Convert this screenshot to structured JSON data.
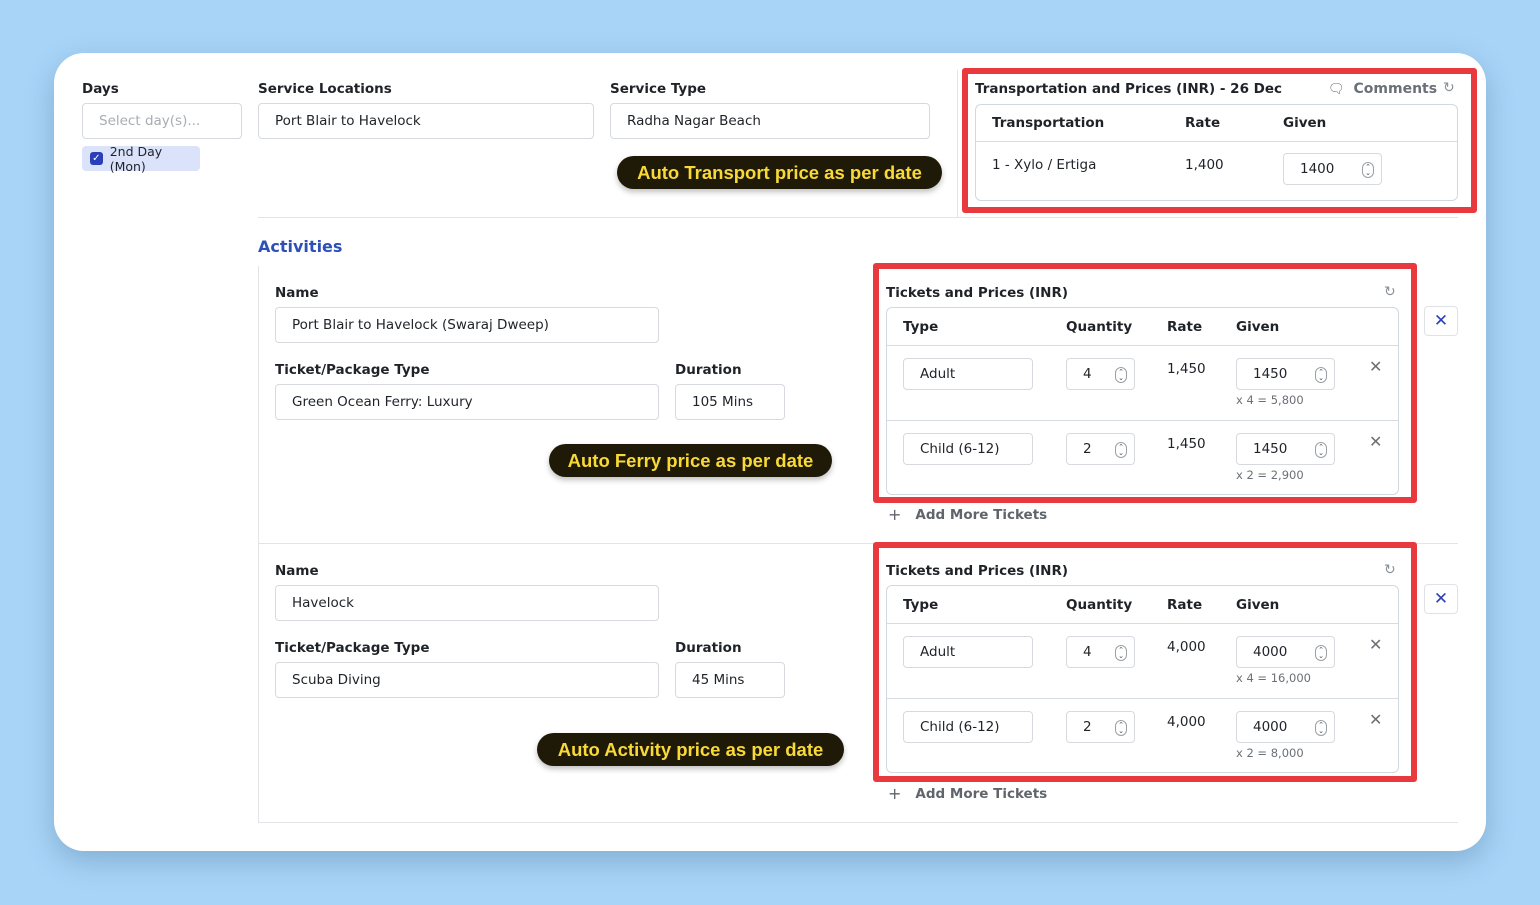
{
  "filters": {
    "days": {
      "label": "Days",
      "placeholder": "Select day(s)...",
      "selected_chip": "2nd Day (Mon)",
      "chip_checked": true
    },
    "service_locations": {
      "label": "Service Locations",
      "value": "Port Blair to Havelock"
    },
    "service_type": {
      "label": "Service Type",
      "value": "Radha Nagar Beach"
    }
  },
  "callouts": {
    "transport": "Auto Transport price as per date",
    "ferry": "Auto Ferry price as per date",
    "activity": "Auto Activity price as per date"
  },
  "transportation": {
    "title": "Transportation and Prices (INR) - 26 Dec",
    "comments_label": "Comments",
    "icons": {
      "comments": "comment-icon",
      "refresh": "refresh-icon"
    },
    "headers": [
      "Transportation",
      "Rate",
      "Given"
    ],
    "rows": [
      {
        "transportation": "1 - Xylo / Ertiga",
        "rate": "1,400",
        "given": "1400"
      }
    ]
  },
  "activities": {
    "title": "Activities",
    "labels": {
      "name": "Name",
      "ticket_type": "Ticket/Package Type",
      "duration": "Duration"
    },
    "tickets_title": "Tickets and Prices (INR)",
    "ticket_headers": [
      "Type",
      "Quantity",
      "Rate",
      "Given"
    ],
    "add_more_label": "Add More Tickets",
    "items": [
      {
        "name": "Port Blair to Havelock (Swaraj Dweep)",
        "ticket_type": "Green Ocean Ferry: Luxury",
        "duration": "105 Mins",
        "tickets": [
          {
            "type": "Adult",
            "quantity": "4",
            "rate": "1,450",
            "given": "1450",
            "subtotal": "x 4 = 5,800"
          },
          {
            "type": "Child (6-12)",
            "quantity": "2",
            "rate": "1,450",
            "given": "1450",
            "subtotal": "x 2 = 2,900"
          }
        ]
      },
      {
        "name": "Havelock",
        "ticket_type": "Scuba Diving",
        "duration": "45 Mins",
        "tickets": [
          {
            "type": "Adult",
            "quantity": "4",
            "rate": "4,000",
            "given": "4000",
            "subtotal": "x 4 = 16,000"
          },
          {
            "type": "Child (6-12)",
            "quantity": "2",
            "rate": "4,000",
            "given": "4000",
            "subtotal": "x 2 = 8,000"
          }
        ]
      }
    ]
  },
  "colors": {
    "background": "#a7d4f7",
    "highlight_border": "#e8393f",
    "callout_bg": "#1f1a08",
    "callout_text": "#f8d938",
    "accent": "#2d4fb8"
  }
}
